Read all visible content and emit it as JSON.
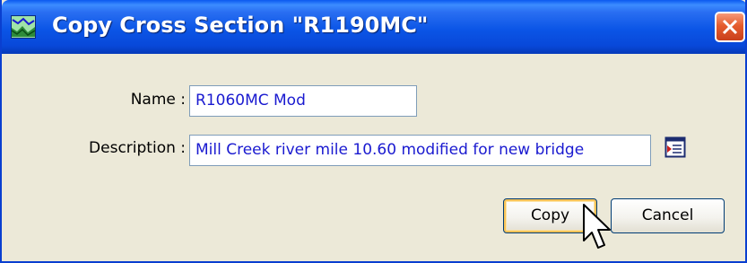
{
  "window": {
    "title": "Copy Cross Section \"R1190MC\"",
    "app_icon": "cross-section-plot-icon",
    "close_icon": "close-icon",
    "colors": {
      "titlebar": "#0b55e6",
      "body": "#ece9d8",
      "close": "#e55c2d",
      "field_text": "#1a1ad0"
    }
  },
  "form": {
    "name_label": "Name :",
    "name_value": "R1060MC Mod",
    "description_label": "Description :",
    "description_value": "Mill Creek river mile 10.60 modified for new bridge",
    "description_edit_icon": "edit-text-icon"
  },
  "buttons": {
    "copy_label": "Copy",
    "cancel_label": "Cancel"
  },
  "cursor": {
    "icon": "mouse-pointer-icon"
  }
}
